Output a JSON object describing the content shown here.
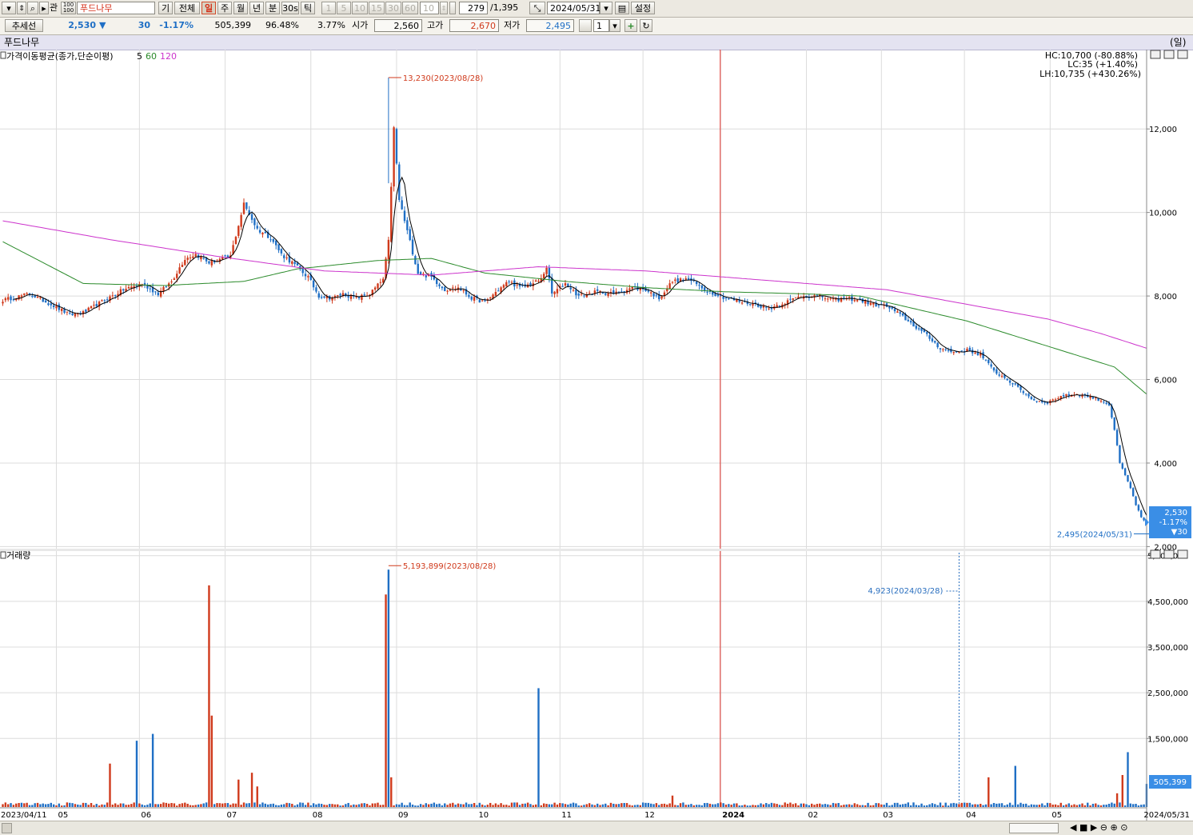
{
  "toolbar": {
    "period_tabs": [
      "기",
      "전체",
      "일",
      "주",
      "월",
      "년",
      "분",
      "30s",
      "틱"
    ],
    "active_period": "일",
    "interval_buttons": [
      "1",
      "5",
      "10",
      "15",
      "30",
      "60"
    ],
    "interval_value": "10",
    "stock_name": "푸드나무",
    "code_label": "관",
    "count_current": "279",
    "count_total": "/1,395",
    "date": "2024/05/31",
    "settings_label": "설정",
    "dropdown_value": "1"
  },
  "quote": {
    "trend_label": "추세선",
    "price": "2,530",
    "change_arrow": "▼",
    "change": "30",
    "change_pct": "-1.17%",
    "volume": "505,399",
    "vol_ratio": "96.48%",
    "turnover": "3.77%",
    "open_label": "시가",
    "open": "2,560",
    "high_label": "고가",
    "high": "2,670",
    "low_label": "저가",
    "low": "2,495"
  },
  "panel_title": "푸드나무",
  "unit_label": "(일)",
  "colors": {
    "up": "#d03a1c",
    "down": "#1f6fc5",
    "ma5": "#000000",
    "ma60": "#2a8a2a",
    "ma120": "#cc33cc",
    "marker": "#e0302a",
    "dashed_marker": "#2a6fbf"
  },
  "chart_data": {
    "type": "candlestick",
    "price_panel": {
      "title": "가격이동평균(종가,단순이평)",
      "ma_periods": [
        "5",
        "60",
        "120"
      ],
      "y_ticks": [
        "2,000",
        "4,000",
        "6,000",
        "8,000",
        "10,000",
        "12,000"
      ],
      "ylim": [
        1950,
        13900
      ],
      "info_lines": [
        {
          "text": "HC:10,700 (-80.88%)",
          "color": "#1f6fc5"
        },
        {
          "text": "LC:35 (+1.40%)",
          "color": "#d03a1c"
        },
        {
          "text": "LH:10,735 (+430.26%)",
          "color": "#000000"
        }
      ],
      "max_annotation": "13,230(2023/08/28)",
      "min_annotation": "2,495(2024/05/31)",
      "last_box": [
        "2,530",
        "-1.17%",
        "▼30"
      ]
    },
    "volume_panel": {
      "title": "거래량",
      "y_ticks": [
        "5,500,000",
        "4,500,000",
        "3,500,000",
        "2,500,000",
        "1,500,000",
        "505,399"
      ],
      "ylim": [
        0,
        5600000
      ],
      "max_annotation": "5,193,899(2023/08/28)",
      "dashed_annotation": "4,923(2024/03/28)"
    },
    "x_ticks": [
      "2023/04/11",
      "05",
      "06",
      "07",
      "08",
      "09",
      "10",
      "11",
      "12",
      "2024",
      "02",
      "03",
      "04",
      "05",
      "2024/05/31"
    ],
    "anchors": [
      [
        0,
        7900
      ],
      [
        10,
        8050
      ],
      [
        18,
        7800
      ],
      [
        25,
        7550
      ],
      [
        30,
        7600
      ],
      [
        38,
        7900
      ],
      [
        45,
        8150
      ],
      [
        52,
        8300
      ],
      [
        58,
        8050
      ],
      [
        63,
        8350
      ],
      [
        68,
        8900
      ],
      [
        72,
        9000
      ],
      [
        77,
        8800
      ],
      [
        85,
        8950
      ],
      [
        90,
        10200
      ],
      [
        95,
        9600
      ],
      [
        100,
        9400
      ],
      [
        104,
        9000
      ],
      [
        108,
        8800
      ],
      [
        114,
        8450
      ],
      [
        118,
        8000
      ],
      [
        123,
        7950
      ],
      [
        127,
        8050
      ],
      [
        132,
        7950
      ],
      [
        137,
        8050
      ],
      [
        142,
        8400
      ],
      [
        144,
        9300
      ],
      [
        146,
        12000
      ],
      [
        148,
        10300
      ],
      [
        152,
        9300
      ],
      [
        155,
        8550
      ],
      [
        160,
        8450
      ],
      [
        165,
        8150
      ],
      [
        170,
        8200
      ],
      [
        175,
        7950
      ],
      [
        180,
        7850
      ],
      [
        185,
        8150
      ],
      [
        189,
        8350
      ],
      [
        193,
        8200
      ],
      [
        198,
        8300
      ],
      [
        201,
        8400
      ],
      [
        203,
        8700
      ],
      [
        205,
        8050
      ],
      [
        210,
        8300
      ],
      [
        215,
        8000
      ],
      [
        222,
        8100
      ],
      [
        228,
        8050
      ],
      [
        235,
        8200
      ],
      [
        240,
        8150
      ],
      [
        245,
        7950
      ],
      [
        250,
        8350
      ],
      [
        256,
        8400
      ],
      [
        262,
        8150
      ],
      [
        270,
        7950
      ],
      [
        276,
        7850
      ],
      [
        281,
        7800
      ],
      [
        286,
        7700
      ],
      [
        292,
        7850
      ],
      [
        298,
        8000
      ],
      [
        305,
        8000
      ],
      [
        310,
        7900
      ],
      [
        315,
        7950
      ],
      [
        320,
        7900
      ],
      [
        325,
        7800
      ],
      [
        330,
        7750
      ],
      [
        335,
        7550
      ],
      [
        340,
        7300
      ],
      [
        345,
        7050
      ],
      [
        350,
        6750
      ],
      [
        355,
        6650
      ],
      [
        360,
        6700
      ],
      [
        365,
        6600
      ],
      [
        370,
        6200
      ],
      [
        375,
        6000
      ],
      [
        380,
        5750
      ],
      [
        385,
        5500
      ],
      [
        390,
        5450
      ],
      [
        395,
        5600
      ],
      [
        400,
        5650
      ],
      [
        405,
        5600
      ],
      [
        410,
        5500
      ],
      [
        413,
        5400
      ],
      [
        415,
        4800
      ],
      [
        417,
        4000
      ],
      [
        419,
        3700
      ],
      [
        421,
        3400
      ],
      [
        423,
        3000
      ],
      [
        425,
        2700
      ],
      [
        427,
        2530
      ]
    ],
    "ma60_points": [
      [
        0,
        9300
      ],
      [
        30,
        8300
      ],
      [
        60,
        8250
      ],
      [
        90,
        8350
      ],
      [
        110,
        8650
      ],
      [
        140,
        8850
      ],
      [
        160,
        8900
      ],
      [
        180,
        8550
      ],
      [
        210,
        8350
      ],
      [
        240,
        8200
      ],
      [
        270,
        8100
      ],
      [
        300,
        8050
      ],
      [
        320,
        8000
      ],
      [
        340,
        7700
      ],
      [
        360,
        7400
      ],
      [
        380,
        7000
      ],
      [
        400,
        6600
      ],
      [
        415,
        6300
      ],
      [
        427,
        5650
      ]
    ],
    "ma120_points": [
      [
        0,
        9800
      ],
      [
        40,
        9350
      ],
      [
        80,
        8950
      ],
      [
        120,
        8600
      ],
      [
        160,
        8500
      ],
      [
        200,
        8700
      ],
      [
        240,
        8600
      ],
      [
        270,
        8450
      ],
      [
        300,
        8300
      ],
      [
        330,
        8150
      ],
      [
        360,
        7800
      ],
      [
        390,
        7450
      ],
      [
        410,
        7100
      ],
      [
        427,
        6750
      ]
    ],
    "volume_spikes": [
      [
        40,
        950000
      ],
      [
        50,
        1450000
      ],
      [
        56,
        1600000
      ],
      [
        77,
        4850000
      ],
      [
        78,
        2000000
      ],
      [
        88,
        600000
      ],
      [
        93,
        750000
      ],
      [
        95,
        450000
      ],
      [
        143,
        4650000
      ],
      [
        144,
        5193899
      ],
      [
        145,
        650000
      ],
      [
        200,
        2600000
      ],
      [
        250,
        250000
      ],
      [
        368,
        650000
      ],
      [
        378,
        900000
      ],
      [
        416,
        300000
      ],
      [
        418,
        700000
      ],
      [
        420,
        1200000
      ]
    ],
    "volume_last": 505399
  }
}
